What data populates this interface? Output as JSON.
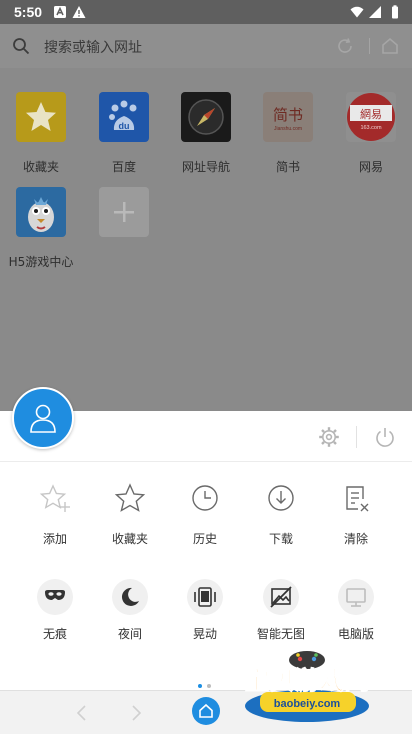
{
  "status_bar": {
    "time": "5:50"
  },
  "search": {
    "placeholder": "搜索或输入网址"
  },
  "speed_dial": [
    {
      "label": "收藏夹",
      "icon": "star-icon"
    },
    {
      "label": "百度",
      "icon": "baidu-icon",
      "sub": "du"
    },
    {
      "label": "网址导航",
      "icon": "compass-icon"
    },
    {
      "label": "简书",
      "icon": "jianshu-icon",
      "sub": "简书",
      "sub2": "Jianshu.com"
    },
    {
      "label": "网易",
      "icon": "netease-icon",
      "sub": "網易",
      "sub2": "163.com"
    },
    {
      "label": "H5游戏中心",
      "icon": "game-mascot-icon"
    },
    {
      "label": "",
      "icon": "add-icon"
    }
  ],
  "menu": {
    "row1": [
      {
        "label": "添加",
        "icon": "add-bookmark-icon"
      },
      {
        "label": "收藏夹",
        "icon": "star-outline-icon"
      },
      {
        "label": "历史",
        "icon": "clock-icon"
      },
      {
        "label": "下载",
        "icon": "download-icon"
      },
      {
        "label": "清除",
        "icon": "clear-icon"
      }
    ],
    "row2": [
      {
        "label": "无痕",
        "icon": "incognito-mask-icon"
      },
      {
        "label": "夜间",
        "icon": "moon-icon"
      },
      {
        "label": "晃动",
        "icon": "shake-phone-icon"
      },
      {
        "label": "智能无图",
        "icon": "no-image-icon"
      },
      {
        "label": "电脑版",
        "icon": "desktop-icon"
      }
    ]
  },
  "pager": {
    "pages": 2,
    "current": 1
  },
  "watermark": {
    "text": "宝贝游戏网",
    "url": "baobeiy.com"
  },
  "colors": {
    "accent": "#1f8de0",
    "scrim": "#8a8a8a",
    "status_bar": "#5f5f5f"
  }
}
